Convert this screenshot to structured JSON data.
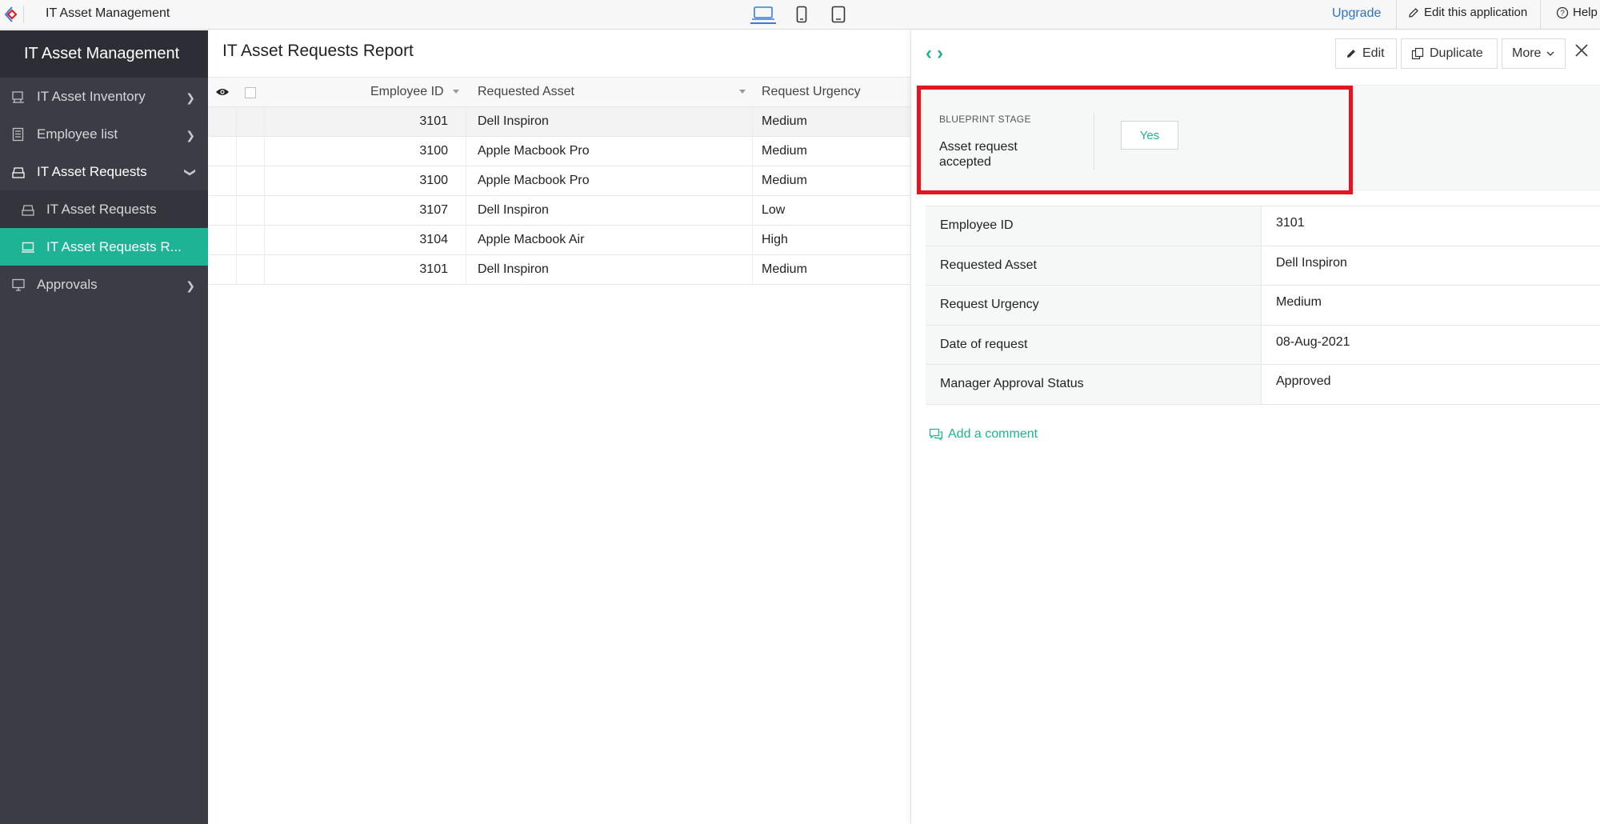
{
  "topbar": {
    "app_name": "IT Asset Management",
    "upgrade": "Upgrade",
    "edit_app": "Edit this application",
    "help": "Help",
    "devices": [
      "desktop-icon",
      "mobile-icon",
      "tablet-icon"
    ]
  },
  "sidebar": {
    "title": "IT Asset Management",
    "items": [
      {
        "label": "IT Asset Inventory",
        "icon": "inventory-icon"
      },
      {
        "label": "Employee list",
        "icon": "list-icon"
      },
      {
        "label": "IT Asset Requests",
        "icon": "requests-icon"
      },
      {
        "label": "IT Asset Requests",
        "icon": "requests-icon"
      },
      {
        "label": "IT Asset Requests R...",
        "icon": "report-icon"
      },
      {
        "label": "Approvals",
        "icon": "approvals-icon"
      }
    ],
    "accent": "#1db394"
  },
  "report": {
    "title": "IT Asset Requests Report",
    "columns": [
      "Employee ID",
      "Requested Asset",
      "Request Urgency"
    ],
    "rows": [
      {
        "emp": "3101",
        "asset": "Dell Inspiron",
        "urgency": "Medium"
      },
      {
        "emp": "3100",
        "asset": "Apple Macbook Pro",
        "urgency": "Medium"
      },
      {
        "emp": "3100",
        "asset": "Apple Macbook Pro",
        "urgency": "Medium"
      },
      {
        "emp": "3107",
        "asset": "Dell Inspiron",
        "urgency": "Low"
      },
      {
        "emp": "3104",
        "asset": "Apple Macbook Air",
        "urgency": "High"
      },
      {
        "emp": "3101",
        "asset": "Dell Inspiron",
        "urgency": "Medium"
      }
    ]
  },
  "detail": {
    "buttons": {
      "edit": "Edit",
      "duplicate": "Duplicate",
      "more": "More"
    },
    "blueprint": {
      "label": "BLUEPRINT STAGE",
      "stage": "Asset request accepted",
      "action": "Yes",
      "highlight_color": "#e4151f"
    },
    "fields": [
      {
        "label": "Employee ID",
        "value": "3101"
      },
      {
        "label": "Requested Asset",
        "value": "Dell Inspiron"
      },
      {
        "label": "Request Urgency",
        "value": "Medium"
      },
      {
        "label": "Date of request",
        "value": "08-Aug-2021"
      },
      {
        "label": "Manager Approval Status",
        "value": "Approved"
      }
    ],
    "add_comment": "Add a comment"
  }
}
